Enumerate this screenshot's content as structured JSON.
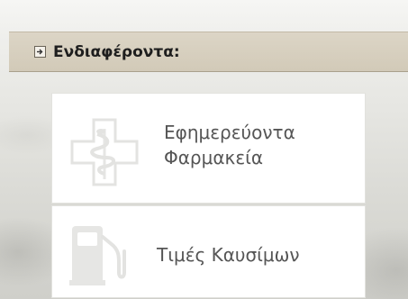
{
  "panel": {
    "title": "Ενδιαφέροντα:",
    "icon": "expand-arrow-icon"
  },
  "links": {
    "pharmacy": {
      "line1": "Εφημερεύοντα",
      "line2": "Φαρμακεία",
      "icon": "pharmacy-cross-icon"
    },
    "fuel": {
      "label": "Τιμές Καυσίμων",
      "icon": "fuel-pump-icon"
    }
  },
  "colors": {
    "header_bg": "#d6cfbf",
    "item_text": "#555555",
    "icon_gray": "#e3e3e1"
  }
}
